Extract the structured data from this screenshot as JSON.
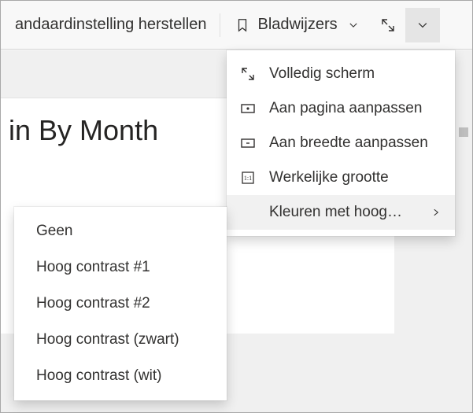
{
  "toolbar": {
    "restore_label": "andaardinstelling herstellen",
    "bookmarks_label": "Bladwijzers"
  },
  "document": {
    "title_fragment": "in By Month"
  },
  "menu": {
    "items": [
      {
        "label": "Volledig scherm"
      },
      {
        "label": "Aan pagina aanpassen"
      },
      {
        "label": "Aan breedte aanpassen"
      },
      {
        "label": "Werkelijke grootte"
      },
      {
        "label": "Kleuren met hoog…",
        "has_submenu": true,
        "hover": true
      }
    ]
  },
  "submenu": {
    "items": [
      {
        "label": "Geen"
      },
      {
        "label": "Hoog contrast #1"
      },
      {
        "label": "Hoog contrast #2"
      },
      {
        "label": "Hoog contrast (zwart)"
      },
      {
        "label": "Hoog contrast (wit)"
      }
    ]
  }
}
